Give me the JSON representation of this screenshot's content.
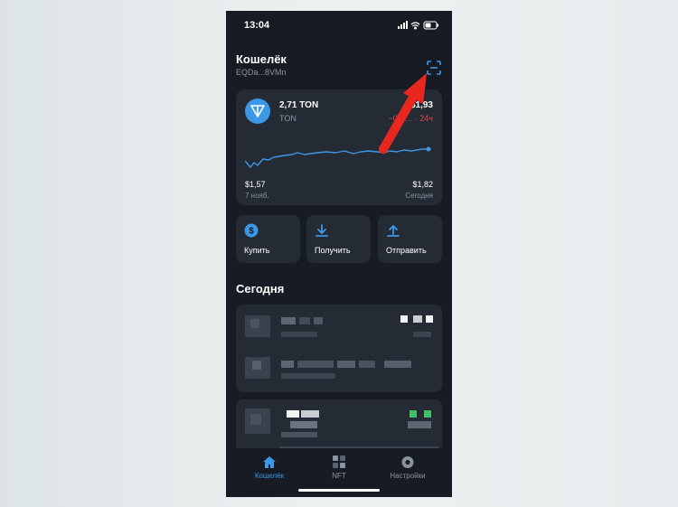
{
  "status_bar": {
    "time": "13:04"
  },
  "header": {
    "title": "Кошелёк",
    "address": "EQDa...8VMn"
  },
  "balance_card": {
    "amount": "2,71 TON",
    "symbol": "TON",
    "price": "$1,93",
    "change": "−0,0… · 24ч",
    "min_price": "$1,57",
    "min_date": "7 нояб.",
    "max_price": "$1,82",
    "max_date": "Сегодня",
    "line_color": "#3c97e6"
  },
  "actions": [
    {
      "label": "Купить",
      "icon": "dollar-icon"
    },
    {
      "label": "Получить",
      "icon": "download-icon"
    },
    {
      "label": "Отправить",
      "icon": "upload-icon"
    }
  ],
  "section_title": "Сегодня",
  "tab_bar": {
    "items": [
      {
        "label": "Кошелёк",
        "icon": "home-icon",
        "active": true
      },
      {
        "label": "NFT",
        "icon": "grid-icon",
        "active": false
      },
      {
        "label": "Настройки",
        "icon": "gear-icon",
        "active": false
      }
    ]
  },
  "colors": {
    "accent": "#3c97e6",
    "negative": "#e04b4b",
    "annotation_arrow": "#e8281e"
  }
}
